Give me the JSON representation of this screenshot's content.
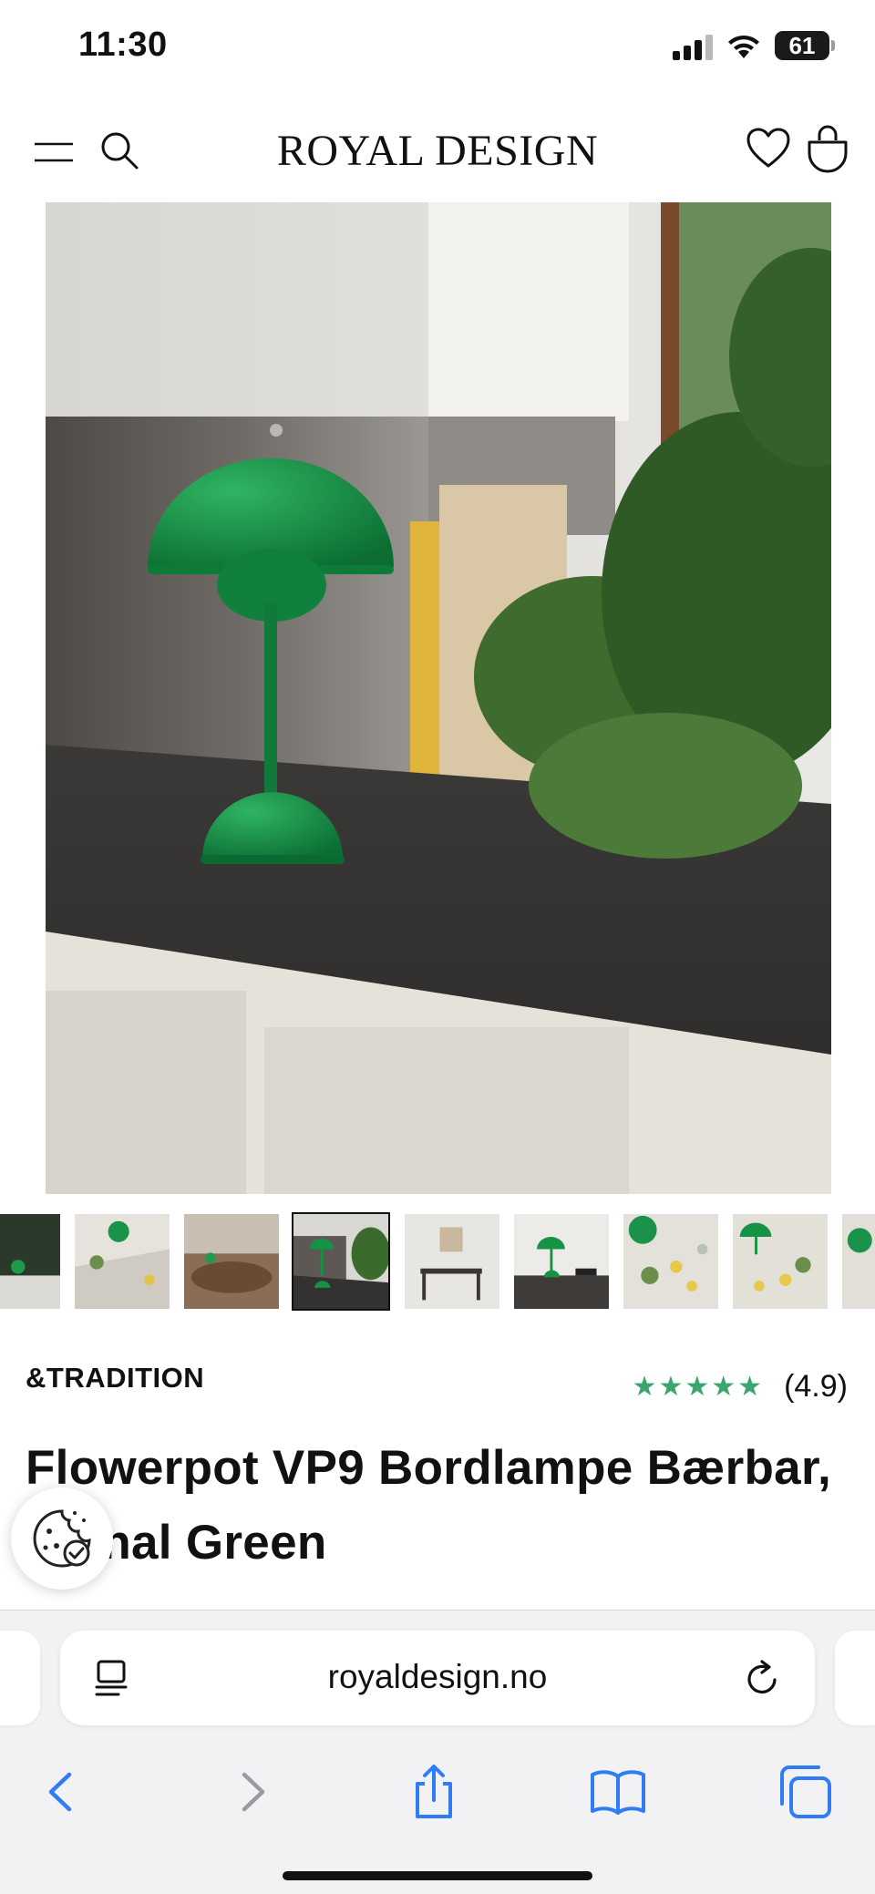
{
  "status": {
    "time": "11:30",
    "battery": "61",
    "battery_level": 0.61
  },
  "header": {
    "brand_logo": "ROYAL DESIGN",
    "icons": [
      "menu-icon",
      "search-icon",
      "heart-icon",
      "bag-icon"
    ]
  },
  "gallery": {
    "thumbnail_count": 9,
    "active_thumbnail": 4
  },
  "product": {
    "brand": "&TRADITION",
    "rating_stars": "★★★★★",
    "rating_value": "(4.9)",
    "title": "Flowerpot VP9 Bordlampe Bærbar, Signal Green"
  },
  "browser": {
    "url": "royaldesign.no",
    "icons": [
      "reader-icon",
      "reload-icon",
      "back-icon",
      "forward-icon",
      "share-icon",
      "bookmarks-icon",
      "tabs-icon"
    ]
  },
  "colors": {
    "accent_blue": "#2f7cf6",
    "star_green": "#3aa66e",
    "lamp_green": "#138a43"
  }
}
